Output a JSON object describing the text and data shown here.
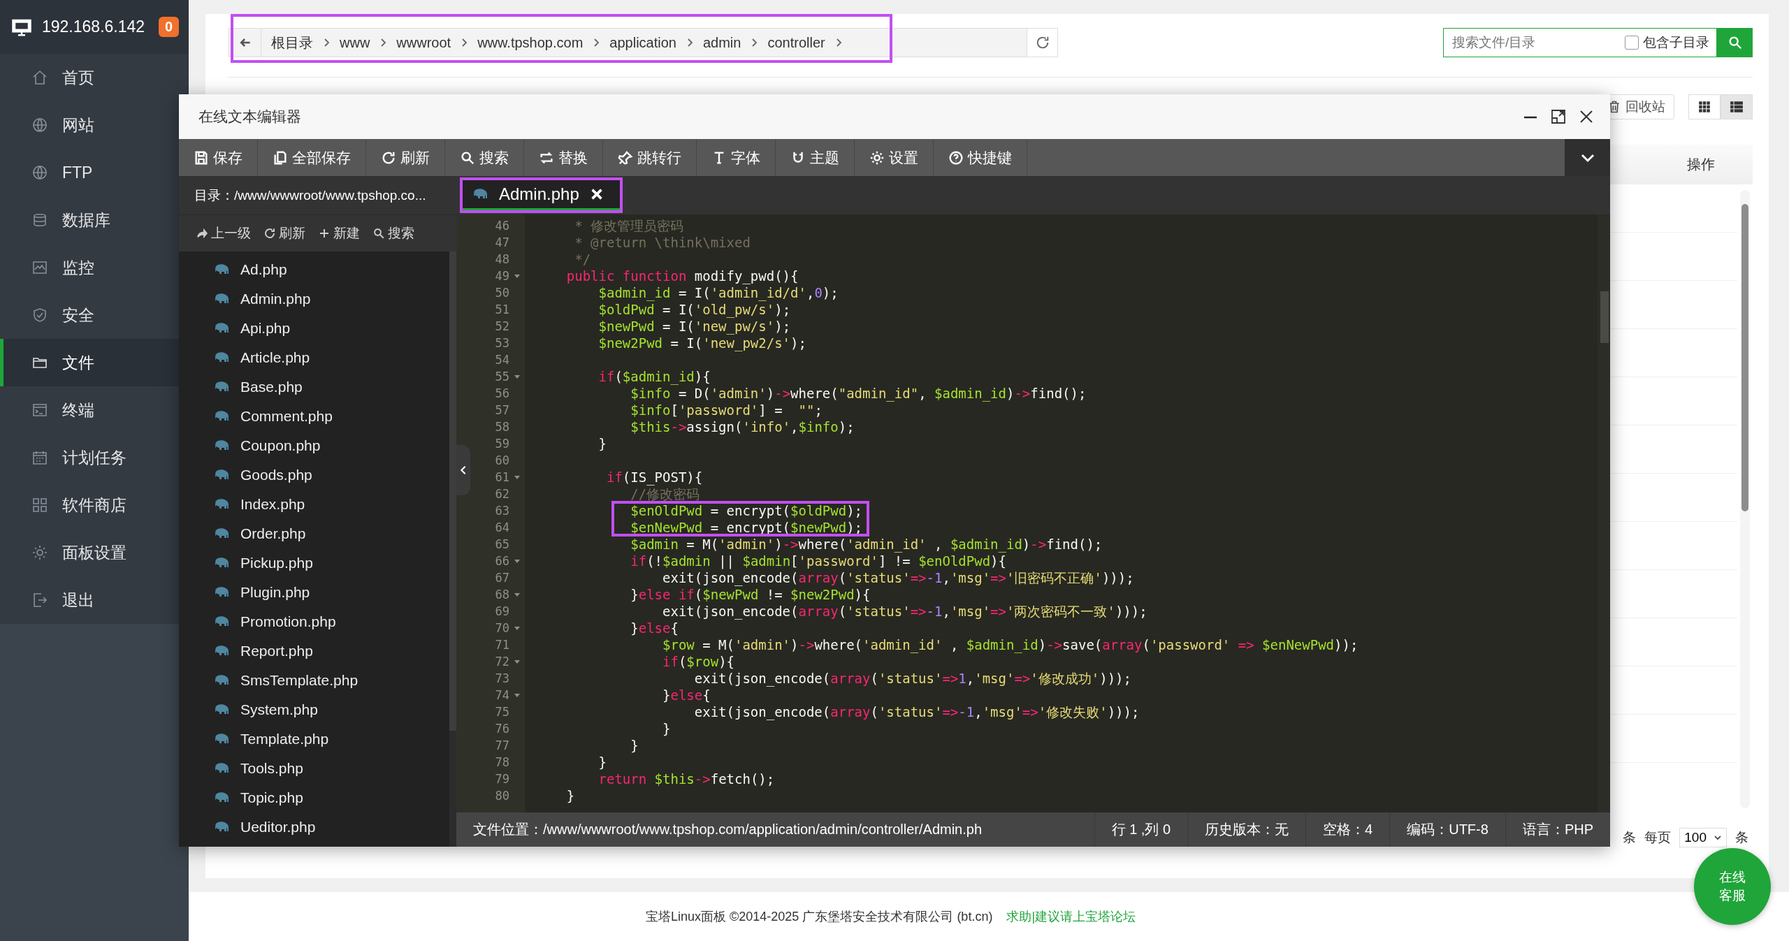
{
  "sidebar": {
    "host": "192.168.6.142",
    "badge": "0",
    "items": [
      {
        "label": "首页",
        "selected": false
      },
      {
        "label": "网站",
        "selected": false
      },
      {
        "label": "FTP",
        "selected": false
      },
      {
        "label": "数据库",
        "selected": false
      },
      {
        "label": "监控",
        "selected": false
      },
      {
        "label": "安全",
        "selected": false
      },
      {
        "label": "文件",
        "selected": true
      },
      {
        "label": "终端",
        "selected": false
      },
      {
        "label": "计划任务",
        "selected": false
      },
      {
        "label": "软件商店",
        "selected": false
      },
      {
        "label": "面板设置",
        "selected": false
      },
      {
        "label": "退出",
        "selected": false
      }
    ]
  },
  "breadcrumb": {
    "highlighted": true,
    "items": [
      "根目录",
      "www",
      "wwwroot",
      "www.tpshop.com",
      "application",
      "admin",
      "controller"
    ]
  },
  "file_search": {
    "placeholder": "搜索文件/目录",
    "include_subdirs": {
      "label": "包含子目录",
      "checked": false
    }
  },
  "toolbar_right": {
    "recycle_bin": "回收站",
    "view_modes": [
      {
        "selected": false
      },
      {
        "selected": true
      }
    ]
  },
  "table": {
    "columns": [
      {
        "label": "操作"
      }
    ]
  },
  "pagination": {
    "count_unit": "条",
    "per_page_label": "每页",
    "per_page": "100",
    "unit": "条"
  },
  "footer": {
    "copyright": "宝塔Linux面板 ©2014-2025 广东堡塔安全技术有限公司 (bt.cn)",
    "link": "求助|建议请上宝塔论坛"
  },
  "chat_button": "在线客服",
  "editor": {
    "title": "在线文本编辑器",
    "toolbar": [
      "保存",
      "全部保存",
      "刷新",
      "搜索",
      "替换",
      "跳转行",
      "字体",
      "主题",
      "设置",
      "快捷键"
    ],
    "directory": "目录：/www/wwwroot/www.tpshop.co...",
    "file_actions": [
      "上一级",
      "刷新",
      "新建",
      "搜索"
    ],
    "files": [
      "Ad.php",
      "Admin.php",
      "Api.php",
      "Article.php",
      "Base.php",
      "Comment.php",
      "Coupon.php",
      "Goods.php",
      "Index.php",
      "Order.php",
      "Pickup.php",
      "Plugin.php",
      "Promotion.php",
      "Report.php",
      "SmsTemplate.php",
      "System.php",
      "Template.php",
      "Tools.php",
      "Topic.php",
      "Ueditor.php"
    ],
    "tabs": [
      {
        "label": "Admin.php",
        "selected": true,
        "highlighted": true
      }
    ],
    "status_bar": [
      "文件位置：/www/wwwroot/www.tpshop.com/application/admin/controller/Admin.ph",
      "行 1 ,列 0",
      "历史版本：无",
      "空格：4",
      "编码：UTF-8",
      "语言：PHP"
    ]
  },
  "code": {
    "lines": [
      {
        "number": "46",
        "fold": false,
        "highlighted": false,
        "tokens": [
          {
            "kind": "comment",
            "text": "     * 修改管理员密码"
          }
        ]
      },
      {
        "number": "47",
        "fold": false,
        "highlighted": false,
        "tokens": [
          {
            "kind": "comment",
            "text": "     * @return \\think\\mixed"
          }
        ]
      },
      {
        "number": "48",
        "fold": false,
        "highlighted": false,
        "tokens": [
          {
            "kind": "comment",
            "text": "     */"
          }
        ]
      },
      {
        "number": "49",
        "fold": true,
        "highlighted": false,
        "tokens": [
          {
            "kind": "kw",
            "text": "    public function"
          },
          {
            "kind": "plain",
            "text": " modify_pwd(){"
          }
        ]
      },
      {
        "number": "50",
        "fold": false,
        "highlighted": false,
        "tokens": [
          {
            "kind": "var",
            "text": "        $admin_id"
          },
          {
            "kind": "plain",
            "text": " = I("
          },
          {
            "kind": "str",
            "text": "'admin_id/d'"
          },
          {
            "kind": "plain",
            "text": ","
          },
          {
            "kind": "num",
            "text": "0"
          },
          {
            "kind": "plain",
            "text": ");"
          }
        ]
      },
      {
        "number": "51",
        "fold": false,
        "highlighted": false,
        "tokens": [
          {
            "kind": "var",
            "text": "        $oldPwd"
          },
          {
            "kind": "plain",
            "text": " = I("
          },
          {
            "kind": "str",
            "text": "'old_pw/s'"
          },
          {
            "kind": "plain",
            "text": ");"
          }
        ]
      },
      {
        "number": "52",
        "fold": false,
        "highlighted": false,
        "tokens": [
          {
            "kind": "var",
            "text": "        $newPwd"
          },
          {
            "kind": "plain",
            "text": " = I("
          },
          {
            "kind": "str",
            "text": "'new_pw/s'"
          },
          {
            "kind": "plain",
            "text": ");"
          }
        ]
      },
      {
        "number": "53",
        "fold": false,
        "highlighted": false,
        "tokens": [
          {
            "kind": "var",
            "text": "        $new2Pwd"
          },
          {
            "kind": "plain",
            "text": " = I("
          },
          {
            "kind": "str",
            "text": "'new_pw2/s'"
          },
          {
            "kind": "plain",
            "text": ");"
          }
        ]
      },
      {
        "number": "54",
        "fold": false,
        "highlighted": false
      },
      {
        "number": "55",
        "fold": true,
        "highlighted": false,
        "tokens": [
          {
            "kind": "kw",
            "text": "        if"
          },
          {
            "kind": "plain",
            "text": "("
          },
          {
            "kind": "var",
            "text": "$admin_id"
          },
          {
            "kind": "plain",
            "text": "){"
          }
        ]
      },
      {
        "number": "56",
        "fold": false,
        "highlighted": false,
        "tokens": [
          {
            "kind": "var",
            "text": "            $info"
          },
          {
            "kind": "plain",
            "text": " = D("
          },
          {
            "kind": "str",
            "text": "'admin'"
          },
          {
            "kind": "plain",
            "text": ")"
          },
          {
            "kind": "op",
            "text": "->"
          },
          {
            "kind": "plain",
            "text": "where("
          },
          {
            "kind": "str",
            "text": "\"admin_id\""
          },
          {
            "kind": "plain",
            "text": ", "
          },
          {
            "kind": "var",
            "text": "$admin_id"
          },
          {
            "kind": "plain",
            "text": ")"
          },
          {
            "kind": "op",
            "text": "->"
          },
          {
            "kind": "plain",
            "text": "find();"
          }
        ]
      },
      {
        "number": "57",
        "fold": false,
        "highlighted": false,
        "tokens": [
          {
            "kind": "var",
            "text": "            $info"
          },
          {
            "kind": "plain",
            "text": "["
          },
          {
            "kind": "str",
            "text": "'password'"
          },
          {
            "kind": "plain",
            "text": "] =  "
          },
          {
            "kind": "str",
            "text": "\"\""
          },
          {
            "kind": "plain",
            "text": ";"
          }
        ]
      },
      {
        "number": "58",
        "fold": false,
        "highlighted": false,
        "tokens": [
          {
            "kind": "var",
            "text": "            $this"
          },
          {
            "kind": "op",
            "text": "->"
          },
          {
            "kind": "plain",
            "text": "assign("
          },
          {
            "kind": "str",
            "text": "'info'"
          },
          {
            "kind": "plain",
            "text": ","
          },
          {
            "kind": "var",
            "text": "$info"
          },
          {
            "kind": "plain",
            "text": ");"
          }
        ]
      },
      {
        "number": "59",
        "fold": false,
        "highlighted": false,
        "tokens": [
          {
            "kind": "plain",
            "text": "        }"
          }
        ]
      },
      {
        "number": "60",
        "fold": false,
        "highlighted": false
      },
      {
        "number": "61",
        "fold": true,
        "highlighted": false,
        "tokens": [
          {
            "kind": "kw",
            "text": "         if"
          },
          {
            "kind": "plain",
            "text": "(IS_POST){"
          }
        ]
      },
      {
        "number": "62",
        "fold": false,
        "highlighted": false,
        "tokens": [
          {
            "kind": "comment",
            "text": "            //修改密码"
          }
        ]
      },
      {
        "number": "63",
        "fold": false,
        "highlighted": true,
        "tokens": [
          {
            "kind": "var",
            "text": "            $enOldPwd"
          },
          {
            "kind": "plain",
            "text": " = encrypt("
          },
          {
            "kind": "var",
            "text": "$oldPwd"
          },
          {
            "kind": "plain",
            "text": ");"
          }
        ]
      },
      {
        "number": "64",
        "fold": false,
        "highlighted": true,
        "tokens": [
          {
            "kind": "var",
            "text": "            $enNewPwd"
          },
          {
            "kind": "plain",
            "text": " = encrypt("
          },
          {
            "kind": "var",
            "text": "$newPwd"
          },
          {
            "kind": "plain",
            "text": ");"
          }
        ]
      },
      {
        "number": "65",
        "fold": false,
        "highlighted": false,
        "tokens": [
          {
            "kind": "var",
            "text": "            $admin"
          },
          {
            "kind": "plain",
            "text": " = M("
          },
          {
            "kind": "str",
            "text": "'admin'"
          },
          {
            "kind": "plain",
            "text": ")"
          },
          {
            "kind": "op",
            "text": "->"
          },
          {
            "kind": "plain",
            "text": "where("
          },
          {
            "kind": "str",
            "text": "'admin_id'"
          },
          {
            "kind": "plain",
            "text": " , "
          },
          {
            "kind": "var",
            "text": "$admin_id"
          },
          {
            "kind": "plain",
            "text": ")"
          },
          {
            "kind": "op",
            "text": "->"
          },
          {
            "kind": "plain",
            "text": "find();"
          }
        ]
      },
      {
        "number": "66",
        "fold": true,
        "highlighted": false,
        "tokens": [
          {
            "kind": "kw",
            "text": "            if"
          },
          {
            "kind": "plain",
            "text": "(!"
          },
          {
            "kind": "var",
            "text": "$admin"
          },
          {
            "kind": "plain",
            "text": " || "
          },
          {
            "kind": "var",
            "text": "$admin"
          },
          {
            "kind": "plain",
            "text": "["
          },
          {
            "kind": "str",
            "text": "'password'"
          },
          {
            "kind": "plain",
            "text": "] != "
          },
          {
            "kind": "var",
            "text": "$enOldPwd"
          },
          {
            "kind": "plain",
            "text": "){"
          }
        ]
      },
      {
        "number": "67",
        "fold": false,
        "highlighted": false,
        "tokens": [
          {
            "kind": "plain",
            "text": "                exit(json_encode("
          },
          {
            "kind": "kw",
            "text": "array"
          },
          {
            "kind": "plain",
            "text": "("
          },
          {
            "kind": "str",
            "text": "'status'"
          },
          {
            "kind": "op",
            "text": "=>"
          },
          {
            "kind": "num",
            "text": "-1"
          },
          {
            "kind": "plain",
            "text": ","
          },
          {
            "kind": "str",
            "text": "'msg'"
          },
          {
            "kind": "op",
            "text": "=>"
          },
          {
            "kind": "str",
            "text": "'旧密码不正确'"
          },
          {
            "kind": "plain",
            "text": ")));"
          }
        ]
      },
      {
        "number": "68",
        "fold": true,
        "highlighted": false,
        "tokens": [
          {
            "kind": "plain",
            "text": "            }"
          },
          {
            "kind": "kw",
            "text": "else if"
          },
          {
            "kind": "plain",
            "text": "("
          },
          {
            "kind": "var",
            "text": "$newPwd"
          },
          {
            "kind": "plain",
            "text": " != "
          },
          {
            "kind": "var",
            "text": "$new2Pwd"
          },
          {
            "kind": "plain",
            "text": "){"
          }
        ]
      },
      {
        "number": "69",
        "fold": false,
        "highlighted": false,
        "tokens": [
          {
            "kind": "plain",
            "text": "                exit(json_encode("
          },
          {
            "kind": "kw",
            "text": "array"
          },
          {
            "kind": "plain",
            "text": "("
          },
          {
            "kind": "str",
            "text": "'status'"
          },
          {
            "kind": "op",
            "text": "=>"
          },
          {
            "kind": "num",
            "text": "-1"
          },
          {
            "kind": "plain",
            "text": ","
          },
          {
            "kind": "str",
            "text": "'msg'"
          },
          {
            "kind": "op",
            "text": "=>"
          },
          {
            "kind": "str",
            "text": "'两次密码不一致'"
          },
          {
            "kind": "plain",
            "text": ")));"
          }
        ]
      },
      {
        "number": "70",
        "fold": true,
        "highlighted": false,
        "tokens": [
          {
            "kind": "plain",
            "text": "            }"
          },
          {
            "kind": "kw",
            "text": "else"
          },
          {
            "kind": "plain",
            "text": "{"
          }
        ]
      },
      {
        "number": "71",
        "fold": false,
        "highlighted": false,
        "tokens": [
          {
            "kind": "var",
            "text": "                $row"
          },
          {
            "kind": "plain",
            "text": " = M("
          },
          {
            "kind": "str",
            "text": "'admin'"
          },
          {
            "kind": "plain",
            "text": ")"
          },
          {
            "kind": "op",
            "text": "->"
          },
          {
            "kind": "plain",
            "text": "where("
          },
          {
            "kind": "str",
            "text": "'admin_id'"
          },
          {
            "kind": "plain",
            "text": " , "
          },
          {
            "kind": "var",
            "text": "$admin_id"
          },
          {
            "kind": "plain",
            "text": ")"
          },
          {
            "kind": "op",
            "text": "->"
          },
          {
            "kind": "plain",
            "text": "save("
          },
          {
            "kind": "kw",
            "text": "array"
          },
          {
            "kind": "plain",
            "text": "("
          },
          {
            "kind": "str",
            "text": "'password'"
          },
          {
            "kind": "op",
            "text": " => "
          },
          {
            "kind": "var",
            "text": "$enNewPwd"
          },
          {
            "kind": "plain",
            "text": "));"
          }
        ]
      },
      {
        "number": "72",
        "fold": true,
        "highlighted": false,
        "tokens": [
          {
            "kind": "kw",
            "text": "                if"
          },
          {
            "kind": "plain",
            "text": "("
          },
          {
            "kind": "var",
            "text": "$row"
          },
          {
            "kind": "plain",
            "text": "){"
          }
        ]
      },
      {
        "number": "73",
        "fold": false,
        "highlighted": false,
        "tokens": [
          {
            "kind": "plain",
            "text": "                    exit(json_encode("
          },
          {
            "kind": "kw",
            "text": "array"
          },
          {
            "kind": "plain",
            "text": "("
          },
          {
            "kind": "str",
            "text": "'status'"
          },
          {
            "kind": "op",
            "text": "=>"
          },
          {
            "kind": "num",
            "text": "1"
          },
          {
            "kind": "plain",
            "text": ","
          },
          {
            "kind": "str",
            "text": "'msg'"
          },
          {
            "kind": "op",
            "text": "=>"
          },
          {
            "kind": "str",
            "text": "'修改成功'"
          },
          {
            "kind": "plain",
            "text": ")));"
          }
        ]
      },
      {
        "number": "74",
        "fold": true,
        "highlighted": false,
        "tokens": [
          {
            "kind": "plain",
            "text": "                }"
          },
          {
            "kind": "kw",
            "text": "else"
          },
          {
            "kind": "plain",
            "text": "{"
          }
        ]
      },
      {
        "number": "75",
        "fold": false,
        "highlighted": false,
        "tokens": [
          {
            "kind": "plain",
            "text": "                    exit(json_encode("
          },
          {
            "kind": "kw",
            "text": "array"
          },
          {
            "kind": "plain",
            "text": "("
          },
          {
            "kind": "str",
            "text": "'status'"
          },
          {
            "kind": "op",
            "text": "=>"
          },
          {
            "kind": "num",
            "text": "-1"
          },
          {
            "kind": "plain",
            "text": ","
          },
          {
            "kind": "str",
            "text": "'msg'"
          },
          {
            "kind": "op",
            "text": "=>"
          },
          {
            "kind": "str",
            "text": "'修改失败'"
          },
          {
            "kind": "plain",
            "text": ")));"
          }
        ]
      },
      {
        "number": "76",
        "fold": false,
        "highlighted": false,
        "tokens": [
          {
            "kind": "plain",
            "text": "                }"
          }
        ]
      },
      {
        "number": "77",
        "fold": false,
        "highlighted": false,
        "tokens": [
          {
            "kind": "plain",
            "text": "            }"
          }
        ]
      },
      {
        "number": "78",
        "fold": false,
        "highlighted": false,
        "tokens": [
          {
            "kind": "plain",
            "text": "        }"
          }
        ]
      },
      {
        "number": "79",
        "fold": false,
        "highlighted": false,
        "tokens": [
          {
            "kind": "kw",
            "text": "        return"
          },
          {
            "kind": "var",
            "text": " $this"
          },
          {
            "kind": "op",
            "text": "->"
          },
          {
            "kind": "plain",
            "text": "fetch();"
          }
        ]
      },
      {
        "number": "80",
        "fold": false,
        "highlighted": false,
        "tokens": [
          {
            "kind": "plain",
            "text": "    }"
          }
        ]
      }
    ]
  }
}
